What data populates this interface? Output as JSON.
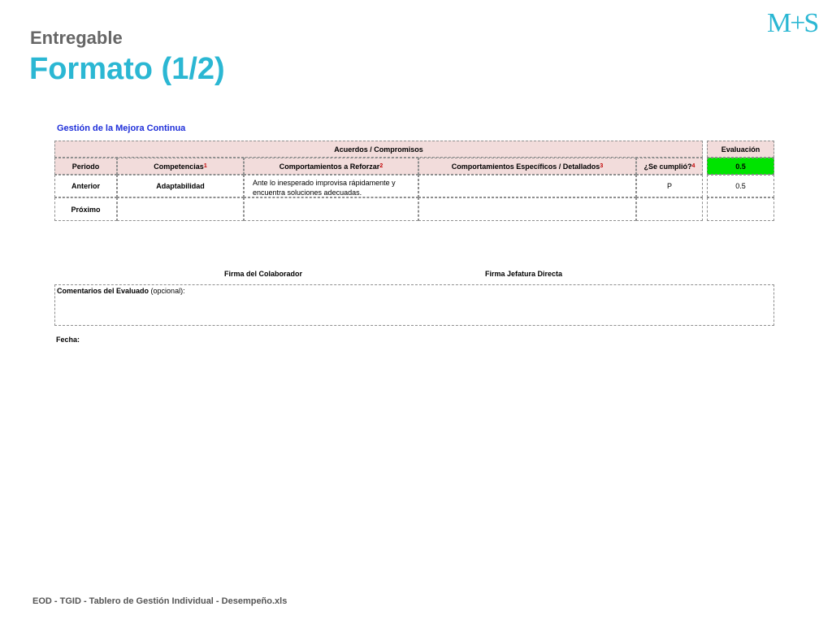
{
  "slide": {
    "subtitle": "Entregable",
    "title": "Formato (1/2)",
    "logo": "M+S",
    "footer": "EOD - TGID - Tablero de Gestión Individual - Desempeño.xls"
  },
  "sheet": {
    "title": "Gestión de la Mejora Continua",
    "group_header": "Acuerdos / Compromisos",
    "evaluation_header": "Evaluación",
    "columns": {
      "periodo": "Periodo",
      "competencias": "Competencias",
      "competencias_note": "1",
      "reforzar": "Comportamientos a Reforzar",
      "reforzar_note": "2",
      "especificos": "Comportamientos Específicos / Detallados",
      "especificos_note": "3",
      "cumplio": "¿Se cumplió?",
      "cumplio_note": "4"
    },
    "evaluation_score": "0.5",
    "rows": [
      {
        "periodo": "Anterior",
        "competencia": "Adaptabilidad",
        "reforzar": "Ante lo inesperado improvisa rápidamente y encuentra soluciones adecuadas.",
        "especificos": "",
        "cumplio": "P",
        "evaluacion": "0.5"
      },
      {
        "periodo": "Próximo",
        "competencia": "",
        "reforzar": "",
        "especificos": "",
        "cumplio": "",
        "evaluacion": ""
      }
    ],
    "signature_colaborador": "Firma del Colaborador",
    "signature_jefatura": "Firma Jefatura Directa",
    "comments_label": "Comentarios del Evaluado",
    "comments_optional": "(opcional):",
    "date_label": "Fecha:"
  },
  "colors": {
    "accent": "#2BB7D3",
    "header_fill": "#F2DCDB",
    "score_fill": "#00E400",
    "sheet_title": "#1F2FD9"
  }
}
